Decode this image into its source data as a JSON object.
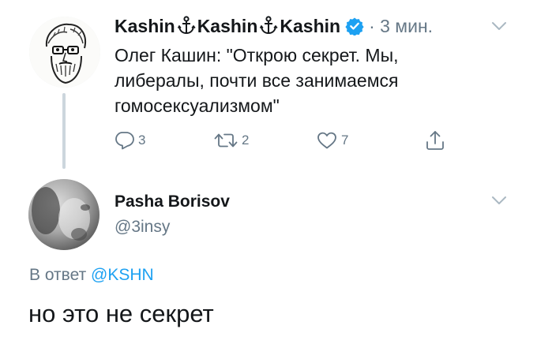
{
  "parent_tweet": {
    "display_name": "Kashin⚓Kashin⚓Kashin",
    "name_parts": [
      "Kashin",
      "Kashin",
      "Kashin"
    ],
    "verified": true,
    "timestamp": "· 3 мин.",
    "text": "Олег Кашин: \"Открою секрет. Мы, либералы, почти все занимаемся гомосексуализмом\"",
    "text_lines": [
      "Олег Кашин: \"Открою секрет. Мы,",
      "либералы, почти все занимаемся",
      "гомосексуализмом\""
    ],
    "actions": {
      "reply_count": "3",
      "retweet_count": "2",
      "like_count": "7"
    },
    "icons": [
      "anchor-icon",
      "verified-badge-icon",
      "chevron-down-icon",
      "reply-icon",
      "retweet-icon",
      "like-icon",
      "share-icon"
    ]
  },
  "reply_tweet": {
    "display_name": "Pasha Borisov",
    "handle": "@3insy",
    "reply_prefix": "В ответ",
    "reply_mention": "@KSHN",
    "text": "но это не секрет"
  },
  "colors": {
    "text": "#14171a",
    "secondary": "#657786",
    "link": "#1da1f2",
    "thread_line": "#ccd6dd",
    "chevron": "#aab8c2"
  }
}
